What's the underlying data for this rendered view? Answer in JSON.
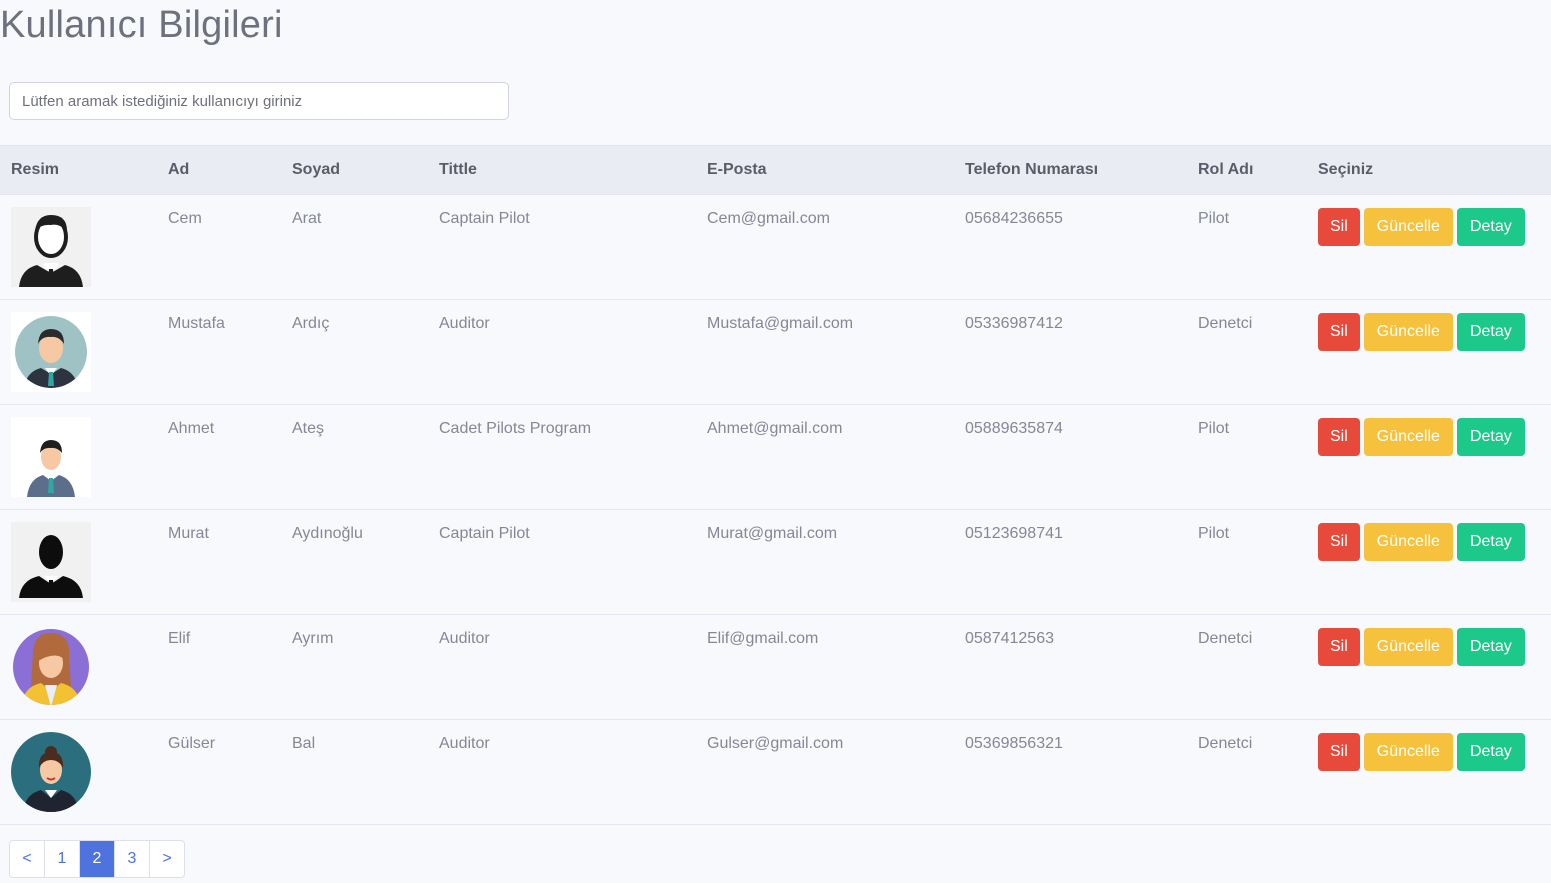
{
  "page": {
    "title": "Kullanıcı Bilgileri"
  },
  "search": {
    "placeholder": "Lütfen aramak istediğiniz kullanıcıyı giriniz",
    "value": ""
  },
  "table": {
    "headers": [
      "Resim",
      "Ad",
      "Soyad",
      "Tittle",
      "E-Posta",
      "Telefon Numarası",
      "Rol Adı",
      "Seçiniz"
    ],
    "rows": [
      {
        "avatar": "man-suit-outline-avatar",
        "ad": "Cem",
        "soyad": "Arat",
        "title": "Captain Pilot",
        "email": "Cem@gmail.com",
        "phone": "05684236655",
        "role": "Pilot"
      },
      {
        "avatar": "man-tie-circle-avatar",
        "ad": "Mustafa",
        "soyad": "Ardıç",
        "title": "Auditor",
        "email": "Mustafa@gmail.com",
        "phone": "05336987412",
        "role": "Denetci"
      },
      {
        "avatar": "man-businessman-avatar",
        "ad": "Ahmet",
        "soyad": "Ateş",
        "title": "Cadet Pilots Program",
        "email": "Ahmet@gmail.com",
        "phone": "05889635874",
        "role": "Pilot"
      },
      {
        "avatar": "man-silhouette-avatar",
        "ad": "Murat",
        "soyad": "Aydınoğlu",
        "title": "Captain Pilot",
        "email": "Murat@gmail.com",
        "phone": "05123698741",
        "role": "Pilot"
      },
      {
        "avatar": "woman-yellow-circle-avatar",
        "ad": "Elif",
        "soyad": "Ayrım",
        "title": "Auditor",
        "email": "Elif@gmail.com",
        "phone": "0587412563",
        "role": "Denetci"
      },
      {
        "avatar": "woman-teal-circle-avatar",
        "ad": "Gülser",
        "soyad": "Bal",
        "title": "Auditor",
        "email": "Gulser@gmail.com",
        "phone": "05369856321",
        "role": "Denetci"
      }
    ],
    "actions": {
      "delete_label": "Sil",
      "update_label": "Güncelle",
      "detail_label": "Detay"
    }
  },
  "pagination": {
    "prev": "<",
    "pages": [
      "1",
      "2",
      "3"
    ],
    "active": "2",
    "next": ">"
  },
  "colors": {
    "delete": "#e74a3b",
    "update": "#f6c23e",
    "detail": "#1cc88a",
    "primary": "#4e73df",
    "header_bg": "#eaecf4",
    "page_bg": "#f8f9fc"
  }
}
